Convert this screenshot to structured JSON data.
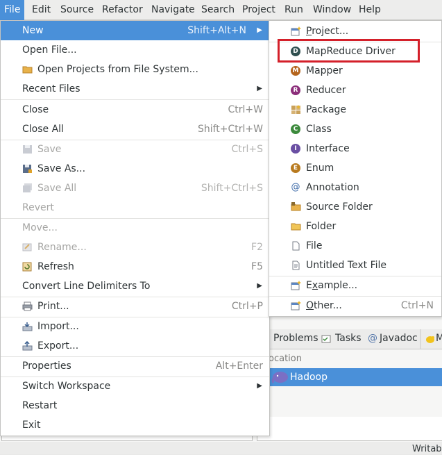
{
  "menubar": [
    "File",
    "Edit",
    "Source",
    "Refactor",
    "Navigate",
    "Search",
    "Project",
    "Run",
    "Window",
    "Help"
  ],
  "file_menu": {
    "new": {
      "label": "New",
      "shortcut": "Shift+Alt+N"
    },
    "open_file": "Open File...",
    "open_projects": "Open Projects from File System...",
    "recent_files": "Recent Files",
    "close": {
      "label": "Close",
      "shortcut": "Ctrl+W"
    },
    "close_all": {
      "label": "Close All",
      "shortcut": "Shift+Ctrl+W"
    },
    "save": {
      "label": "Save",
      "shortcut": "Ctrl+S"
    },
    "save_as": "Save As...",
    "save_all": {
      "label": "Save All",
      "shortcut": "Shift+Ctrl+S"
    },
    "revert": "Revert",
    "move": "Move...",
    "rename": {
      "label": "Rename...",
      "shortcut": "F2"
    },
    "refresh": {
      "label": "Refresh",
      "shortcut": "F5"
    },
    "convert": "Convert Line Delimiters To",
    "print": {
      "label": "Print...",
      "shortcut": "Ctrl+P"
    },
    "import": "Import...",
    "export": "Export...",
    "properties": {
      "label": "Properties",
      "shortcut": "Alt+Enter"
    },
    "switch_workspace": "Switch Workspace",
    "restart": "Restart",
    "exit": "Exit"
  },
  "new_submenu": {
    "project": {
      "pre": "",
      "u": "P",
      "post": "roject..."
    },
    "mapreduce_driver": "MapReduce Driver",
    "mapper": "Mapper",
    "reducer": "Reducer",
    "package": "Package",
    "class": "Class",
    "interface": "Interface",
    "enum": "Enum",
    "annotation": "Annotation",
    "source_folder": "Source Folder",
    "folder": "Folder",
    "file": "File",
    "untitled_text_file": "Untitled Text File",
    "example": {
      "pre": "E",
      "u": "x",
      "post": "ample..."
    },
    "other": {
      "pre": "",
      "u": "O",
      "post": "ther...",
      "shortcut": "Ctrl+N"
    }
  },
  "views": {
    "problems": "Problems",
    "tasks": "Tasks",
    "javadoc": "Javadoc",
    "more": "M",
    "location_header": "ocation",
    "location_row": "Hadoop"
  },
  "status": {
    "text": "Writab"
  },
  "colors": {
    "accent": "#4a90d9",
    "highlight_box": "#d4202a"
  }
}
